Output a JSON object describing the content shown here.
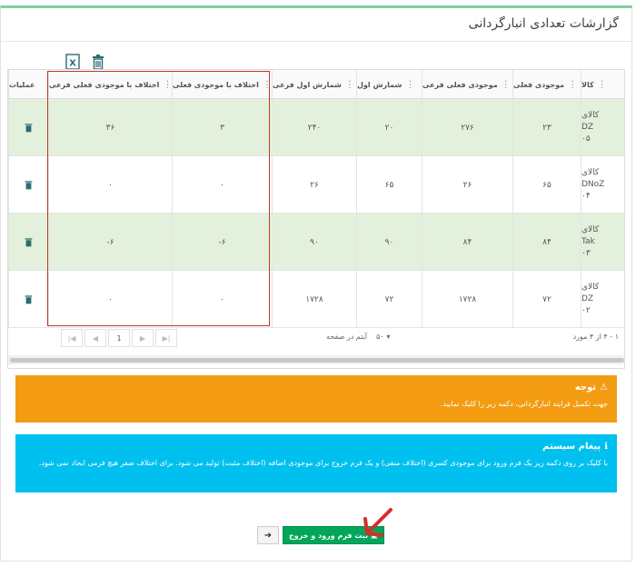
{
  "page": {
    "title": "گزارشات تعدادی انبارگردانی"
  },
  "toolbar": {
    "excel_icon": "excel-icon",
    "delete_icon": "trash-icon"
  },
  "table": {
    "columns": [
      {
        "key": "item",
        "label": "کالا"
      },
      {
        "key": "current_stock",
        "label": "موجودی فعلی"
      },
      {
        "key": "current_stock_sub",
        "label": "موجودی فعلی فرعی"
      },
      {
        "key": "first_count",
        "label": "شمارش اول"
      },
      {
        "key": "first_count_sub",
        "label": "شمارش اول فرعی"
      },
      {
        "key": "diff_current",
        "label": "اختلاف با موجودی فعلی"
      },
      {
        "key": "diff_current_sub",
        "label": "اختلاف با موجودی فعلی فرعی"
      },
      {
        "key": "ops",
        "label": "عملیات"
      }
    ],
    "rows": [
      {
        "item": [
          "کالای",
          "DZ",
          "۰۵"
        ],
        "current_stock": "۲۳",
        "current_stock_sub": "۲۷۶",
        "first_count": "۲۰",
        "first_count_sub": "۲۴۰",
        "diff_current": "۳",
        "diff_current_sub": "۳۶"
      },
      {
        "item": [
          "کالای",
          "DNoZ",
          "۰۴"
        ],
        "current_stock": "۶۵",
        "current_stock_sub": "۲۶",
        "first_count": "۶۵",
        "first_count_sub": "۲۶",
        "diff_current": "۰",
        "diff_current_sub": "۰"
      },
      {
        "item": [
          "کالای",
          "Tak",
          "۰۳"
        ],
        "current_stock": "۸۴",
        "current_stock_sub": "۸۴",
        "first_count": "۹۰",
        "first_count_sub": "۹۰",
        "diff_current": "-۶",
        "diff_current_sub": "-۶"
      },
      {
        "item": [
          "کالای",
          "DZ",
          "۰۲"
        ],
        "current_stock": "۷۲",
        "current_stock_sub": "۱۷۲۸",
        "first_count": "۷۲",
        "first_count_sub": "۱۷۲۸",
        "diff_current": "۰",
        "diff_current_sub": "۰"
      }
    ]
  },
  "pager": {
    "first": "|◀",
    "prev": "◀",
    "current_page": "1",
    "next": "▶",
    "last": "▶|",
    "page_size": "۵۰",
    "page_size_label": "آیتم در صفحه",
    "range": "۱ - ۴ از ۴ مورد"
  },
  "alerts": {
    "warning": {
      "title": "توجه",
      "body": "جهت تکمیل فرایند انبارگردانی، دکمه زیر را کلیک نمایید.",
      "color": "#f39c12"
    },
    "info": {
      "title": "پیغام سیستم",
      "body": "با کلیک بر روی دکمه زیر یک فرم ورود برای موجودی کسری (اختلاف منفی) و یک فرم خروج برای موجودی اضافه (اختلاف مثبت) تولید می شود. برای اختلاف صفر هیچ فرمی ایجاد نمی شود.",
      "color": "#00c0ef"
    }
  },
  "actions": {
    "back": "➜",
    "submit": "ثبت فرم ورود و خروج"
  },
  "colors": {
    "accent_green": "#00a65a",
    "row_highlight": "#e3f1dc",
    "annotation_red": "#c0392b"
  }
}
